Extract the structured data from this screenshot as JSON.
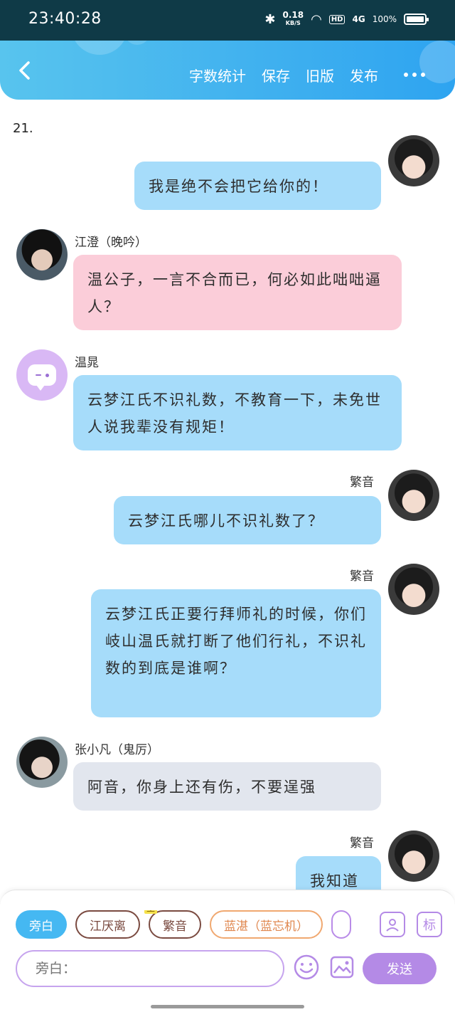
{
  "status_bar": {
    "time": "23:40:28",
    "net_speed": "0.18",
    "net_unit": "KB/S",
    "hd": "HD",
    "signal": "4G",
    "battery": "100%"
  },
  "header": {
    "nav": [
      "字数统计",
      "保存",
      "旧版",
      "发布"
    ]
  },
  "chapter": "21.",
  "messages": [
    {
      "side": "right",
      "speaker": "",
      "text": "我是绝不会把它给你的！",
      "color": "#a6dcfa"
    },
    {
      "side": "left",
      "speaker": "江澄（晚吟）",
      "text": "温公子，一言不合而已，何必如此咄咄逼人？",
      "color": "#fbcdd9"
    },
    {
      "side": "left",
      "speaker": "温晁",
      "text": "云梦江氏不识礼数，不教育一下，未免世人说我辈没有规矩！",
      "color": "#a6dcfa"
    },
    {
      "side": "right",
      "speaker": "繁音",
      "text": "云梦江氏哪儿不识礼数了？",
      "color": "#a6dcfa"
    },
    {
      "side": "right",
      "speaker": "繁音",
      "text": "云梦江氏正要行拜师礼的时候，你们岐山温氏就打断了他们行礼，不识礼数的到底是谁啊？",
      "color": "#a6dcfa"
    },
    {
      "side": "left",
      "speaker": "张小凡（鬼厉）",
      "text": "阿音，你身上还有伤，不要逞强",
      "color": "#e2e6ee"
    },
    {
      "side": "right",
      "speaker": "繁音",
      "text": "我知道",
      "color": "#a6dcfa"
    }
  ],
  "composer": {
    "chips": [
      "旁白",
      "江厌离",
      "繁音",
      "蓝湛（蓝忘机）"
    ],
    "main_tag": "主",
    "placeholder": "旁白：",
    "send_label": "发送",
    "tag_button": "标"
  }
}
